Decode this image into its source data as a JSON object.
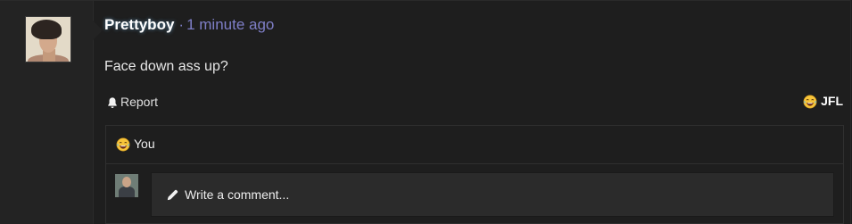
{
  "post": {
    "username": "Prettyboy",
    "separator": "·",
    "timestamp": "1 minute ago",
    "text": "Face down ass up?",
    "avatar_icon": "user-avatar-photo"
  },
  "actions": {
    "report_label": "Report",
    "report_icon": "bell-icon",
    "reaction_label": "JFL",
    "reaction_icon": "laughing-crying-emoji-icon"
  },
  "reactions": {
    "you_label": "You",
    "you_icon": "laughing-crying-emoji-icon"
  },
  "comment": {
    "placeholder": "Write a comment...",
    "input_icon": "pencil-icon"
  },
  "colors": {
    "background": "#1e1e1e",
    "timestamp": "#7f7fc8",
    "username": "#ffffff"
  }
}
